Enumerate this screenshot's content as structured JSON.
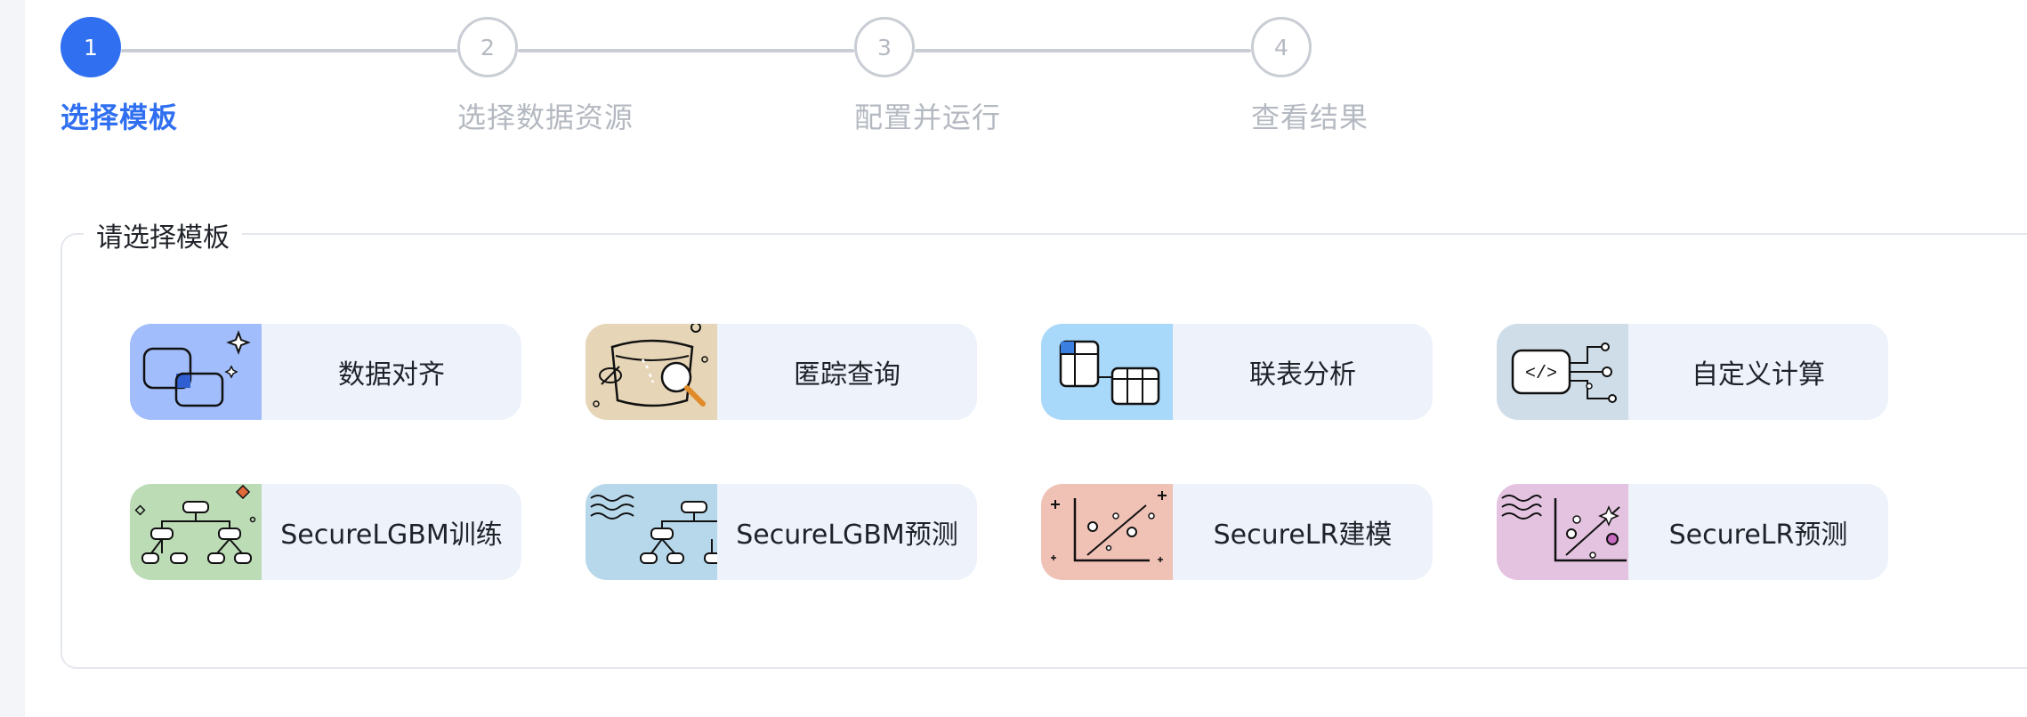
{
  "steps": [
    {
      "number": "1",
      "label": "选择模板",
      "status": "active"
    },
    {
      "number": "2",
      "label": "选择数据资源",
      "status": "inactive"
    },
    {
      "number": "3",
      "label": "配置并运行",
      "status": "inactive"
    },
    {
      "number": "4",
      "label": "查看结果",
      "status": "inactive"
    }
  ],
  "panel": {
    "title": "请选择模板"
  },
  "templates": [
    {
      "label": "数据对齐",
      "icon": "overlapping-windows-icon",
      "color": "#a2bdfb"
    },
    {
      "label": "匿踪查询",
      "icon": "hidden-search-icon",
      "color": "#e6d5b6"
    },
    {
      "label": "联表分析",
      "icon": "joined-tables-icon",
      "color": "#a8d8fa"
    },
    {
      "label": "自定义计算",
      "icon": "custom-code-icon",
      "color": "#cfdde8"
    },
    {
      "label": "SecureLGBM训练",
      "icon": "tree-model-train-icon",
      "color": "#bcdcb6"
    },
    {
      "label": "SecureLGBM预测",
      "icon": "tree-model-predict-icon",
      "color": "#b7d7ea"
    },
    {
      "label": "SecureLR建模",
      "icon": "regression-model-icon",
      "color": "#f0c1b5"
    },
    {
      "label": "SecureLR预测",
      "icon": "regression-predict-icon",
      "color": "#e4c3e0"
    }
  ],
  "colors": {
    "accent": "#2f6ff0",
    "inactive": "#b4b9c1",
    "card_bg": "#edf2fb"
  }
}
